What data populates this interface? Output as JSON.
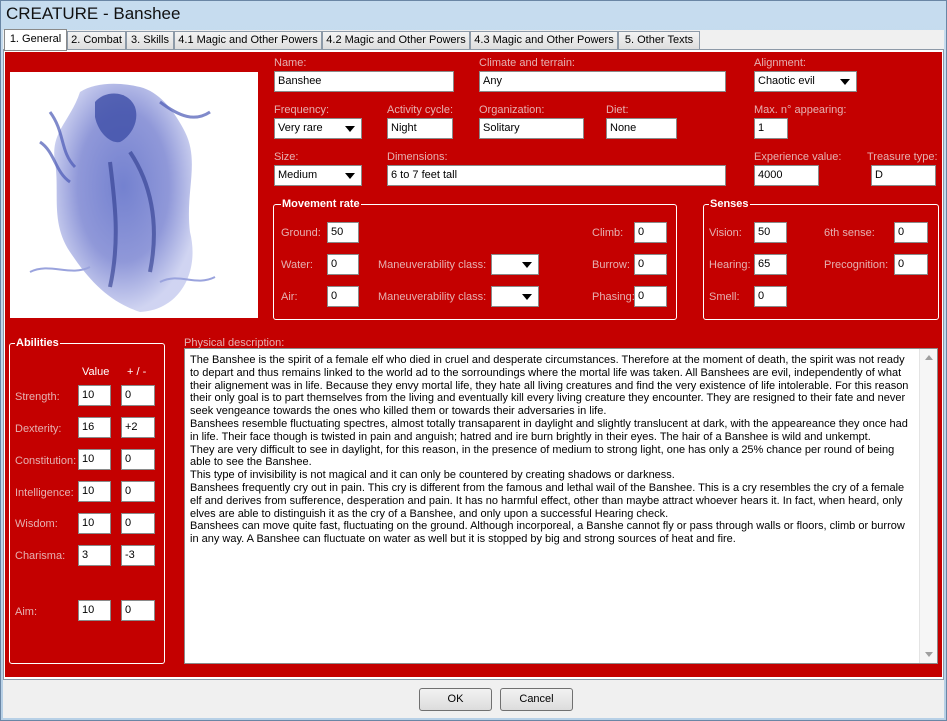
{
  "window": {
    "title": "CREATURE - Banshee"
  },
  "tabs": [
    {
      "label": "1. General"
    },
    {
      "label": "2. Combat"
    },
    {
      "label": "3. Skills"
    },
    {
      "label": "4.1 Magic and Other Powers"
    },
    {
      "label": "4.2 Magic and Other Powers"
    },
    {
      "label": "4.3 Magic and Other Powers"
    },
    {
      "label": "5. Other Texts"
    }
  ],
  "general": {
    "name": {
      "label": "Name:",
      "value": "Banshee"
    },
    "climate": {
      "label": "Climate and terrain:",
      "value": "Any"
    },
    "alignment": {
      "label": "Alignment:",
      "value": "Chaotic evil"
    },
    "frequency": {
      "label": "Frequency:",
      "value": "Very rare"
    },
    "activity": {
      "label": "Activity cycle:",
      "value": "Night"
    },
    "organization": {
      "label": "Organization:",
      "value": "Solitary"
    },
    "diet": {
      "label": "Diet:",
      "value": "None"
    },
    "max_appearing": {
      "label": "Max. n° appearing:",
      "value": "1"
    },
    "size": {
      "label": "Size:",
      "value": "Medium"
    },
    "dimensions": {
      "label": "Dimensions:",
      "value": "6 to 7 feet tall"
    },
    "experience": {
      "label": "Experience value:",
      "value": "4000"
    },
    "treasure": {
      "label": "Treasure type:",
      "value": "D"
    }
  },
  "movement": {
    "title": "Movement rate",
    "ground": {
      "label": "Ground:",
      "value": "50"
    },
    "water": {
      "label": "Water:",
      "value": "0"
    },
    "air": {
      "label": "Air:",
      "value": "0"
    },
    "maneuver1": {
      "label": "Maneuverability class:",
      "value": ""
    },
    "maneuver2": {
      "label": "Maneuverability class:",
      "value": ""
    },
    "climb": {
      "label": "Climb:",
      "value": "0"
    },
    "burrow": {
      "label": "Burrow:",
      "value": "0"
    },
    "phasing": {
      "label": "Phasing:",
      "value": "0"
    }
  },
  "senses": {
    "title": "Senses",
    "vision": {
      "label": "Vision:",
      "value": "50"
    },
    "hearing": {
      "label": "Hearing:",
      "value": "65"
    },
    "smell": {
      "label": "Smell:",
      "value": "0"
    },
    "sixth": {
      "label": "6th sense:",
      "value": "0"
    },
    "precognition": {
      "label": "Precognition:",
      "value": "0"
    }
  },
  "abilities": {
    "title": "Abilities",
    "col_value": "Value",
    "col_mod": "+ / -",
    "rows": [
      {
        "label": "Strength:",
        "value": "10",
        "mod": "0"
      },
      {
        "label": "Dexterity:",
        "value": "16",
        "mod": "+2"
      },
      {
        "label": "Constitution:",
        "value": "10",
        "mod": "0"
      },
      {
        "label": "Intelligence:",
        "value": "10",
        "mod": "0"
      },
      {
        "label": "Wisdom:",
        "value": "10",
        "mod": "0"
      },
      {
        "label": "Charisma:",
        "value": "3",
        "mod": "-3"
      },
      {
        "label": "Aim:",
        "value": "10",
        "mod": "0"
      }
    ]
  },
  "description": {
    "label": "Physical description:",
    "text": "The Banshee is the spirit of a female elf who died in cruel and desperate circumstances. Therefore at the moment of death, the spirit was not ready to depart and thus remains linked to the world ad to the sorroundings where the mortal life was taken. All Banshees are evil, independently of what their alignement was in life. Because they envy mortal life, they hate all living creatures and find the very existence of life intolerable. For this reason their only goal is to part themselves from the living and eventually kill every living creature they encounter. They are resigned to their fate and never seek vengeance towards the ones who killed them or towards their adversaries in life.\nBanshees resemble fluctuating spectres, almost totally transaparent in daylight and slightly translucent at dark, with the appeareance they once had in life. Their face though is twisted in pain and anguish; hatred and ire burn brightly in their eyes. The hair of a Banshee is wild and unkempt.\nThey are very difficult to see in daylight, for this reason, in the presence of medium to strong light, one has only a 25% chance per round of being able to see the Banshee.\nThis type of invisibility is not magical and it can only be countered by creating shadows or darkness.\nBanshees frequently cry out in pain. This cry is different from the famous and lethal wail of the Banshee. This is a cry resembles the cry of a female elf and derives from sufference, desperation and pain. It has no harmful effect, other than maybe attract whoever hears it. In fact, when heard, only elves are able to distinguish it as the cry of a Banshee, and only upon a successful Hearing check.\nBanshees can move quite fast, fluctuating on the ground. Although incorporeal, a Banshe cannot fly or pass through walls or floors, climb or burrow in any way. A Banshee can fluctuate on water as well but it is stopped by big and strong sources of heat and fire."
  },
  "buttons": {
    "ok": "OK",
    "cancel": "Cancel"
  }
}
